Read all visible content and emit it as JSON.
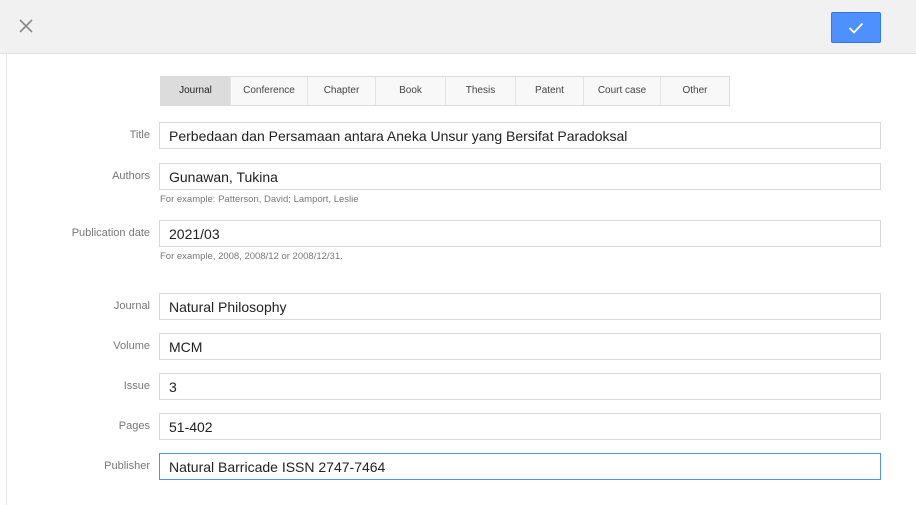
{
  "header": {
    "close_icon": "close-icon",
    "save_icon": "checkmark-icon",
    "accent_color": "#4d90fe"
  },
  "tabs": [
    {
      "label": "Journal",
      "active": true
    },
    {
      "label": "Conference",
      "active": false
    },
    {
      "label": "Chapter",
      "active": false
    },
    {
      "label": "Book",
      "active": false
    },
    {
      "label": "Thesis",
      "active": false
    },
    {
      "label": "Patent",
      "active": false
    },
    {
      "label": "Court case",
      "active": false
    },
    {
      "label": "Other",
      "active": false
    }
  ],
  "form": {
    "title": {
      "label": "Title",
      "value": "Perbedaan dan Persamaan antara Aneka Unsur yang Bersifat Paradoksal"
    },
    "authors": {
      "label": "Authors",
      "value": "Gunawan, Tukina",
      "hint": "For example: Patterson, David; Lamport, Leslie"
    },
    "publication_date": {
      "label": "Publication date",
      "value": "2021/03",
      "hint": "For example, 2008, 2008/12 or 2008/12/31."
    },
    "journal": {
      "label": "Journal",
      "value": "Natural Philosophy"
    },
    "volume": {
      "label": "Volume",
      "value": "MCM"
    },
    "issue": {
      "label": "Issue",
      "value": "3"
    },
    "pages": {
      "label": "Pages",
      "value": "51-402"
    },
    "publisher": {
      "label": "Publisher",
      "value": "Natural Barricade ISSN 2747-7464"
    }
  }
}
